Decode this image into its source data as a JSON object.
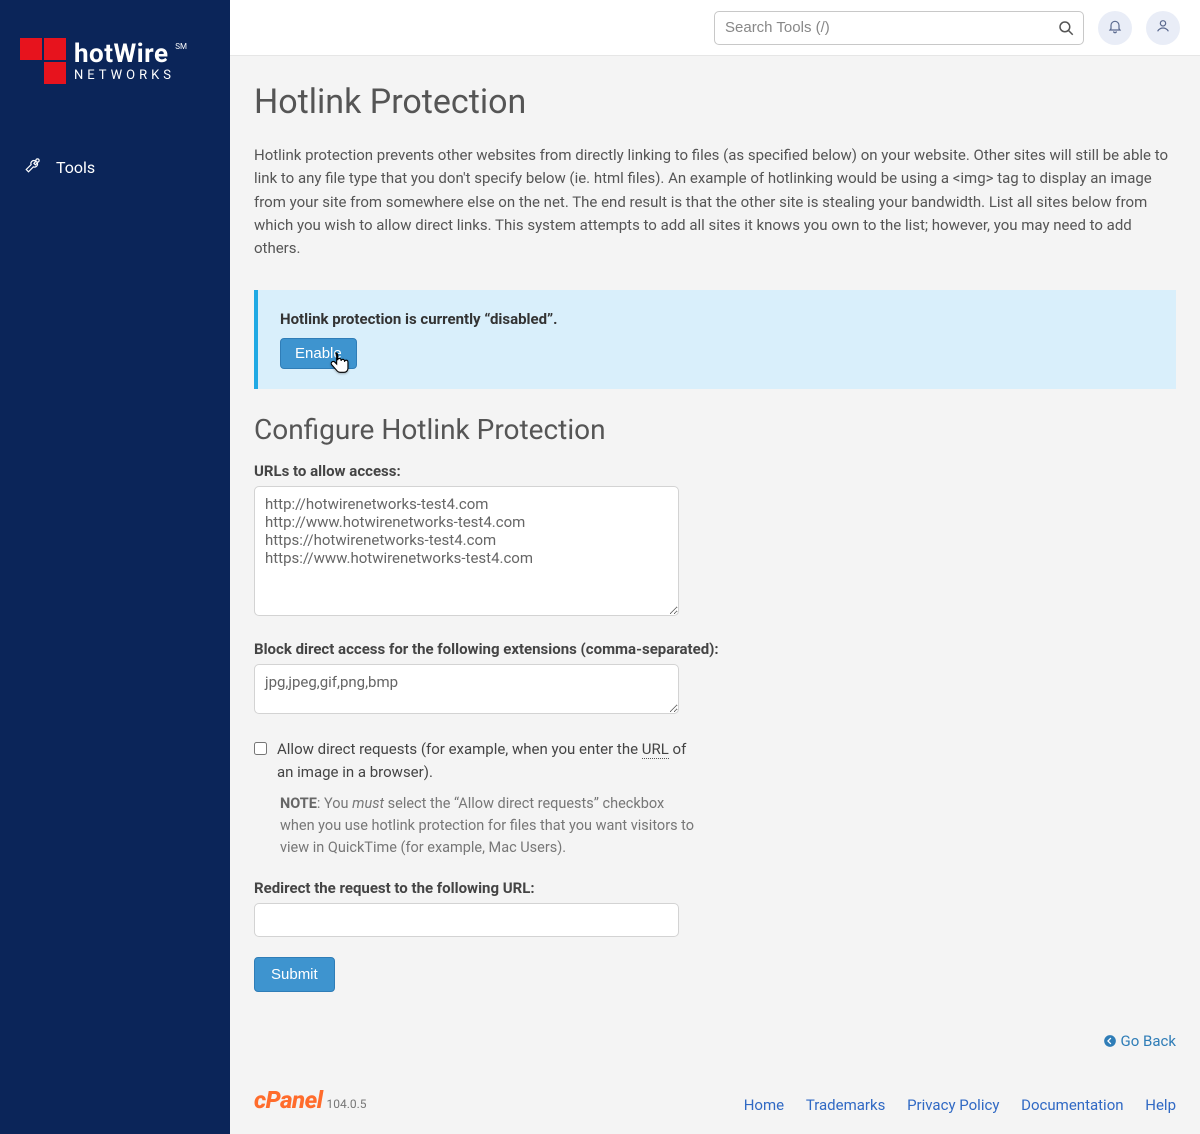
{
  "brand": {
    "name": "hotWire",
    "tagline": "NETWORKS",
    "sm": "SM"
  },
  "sidebar": {
    "tools": "Tools"
  },
  "search": {
    "placeholder": "Search Tools (/)"
  },
  "page": {
    "title": "Hotlink Protection",
    "desc": "Hotlink protection prevents other websites from directly linking to files (as specified below) on your website. Other sites will still be able to link to any file type that you don't specify below (ie. html files). An example of hotlinking would be using a <img> tag to display an image from your site from somewhere else on the net. The end result is that the other site is stealing your bandwidth. List all sites below from which you wish to allow direct links. This system attempts to add all sites it knows you own to the list; however, you may need to add others."
  },
  "status": {
    "text": "Hotlink protection is currently “disabled”.",
    "enable_btn": "Enable"
  },
  "configure": {
    "heading": "Configure Hotlink Protection",
    "urls_label": "URLs to allow access:",
    "urls_value": "http://hotwirenetworks-test4.com\nhttp://www.hotwirenetworks-test4.com\nhttps://hotwirenetworks-test4.com\nhttps://www.hotwirenetworks-test4.com",
    "ext_label": "Block direct access for the following extensions (comma-separated):",
    "ext_value": "jpg,jpeg,gif,png,bmp",
    "allow_pre": "Allow direct requests (for example, when you enter the ",
    "allow_url_abbr": "URL",
    "allow_post": " of an image in a browser).",
    "note_b": "NOTE",
    "note_pre": ": You ",
    "note_must": "must",
    "note_post": " select the “Allow direct requests” checkbox when you use hotlink protection for files that you want visitors to view in QuickTime (for example, Mac Users).",
    "redirect_label": "Redirect the request to the following URL:",
    "redirect_value": "",
    "submit": "Submit"
  },
  "goback": "Go Back",
  "cpanel": {
    "name": "cPanel",
    "version": "104.0.5"
  },
  "footer_links": {
    "home": "Home",
    "trademarks": "Trademarks",
    "privacy": "Privacy Policy",
    "docs": "Documentation",
    "help": "Help"
  }
}
